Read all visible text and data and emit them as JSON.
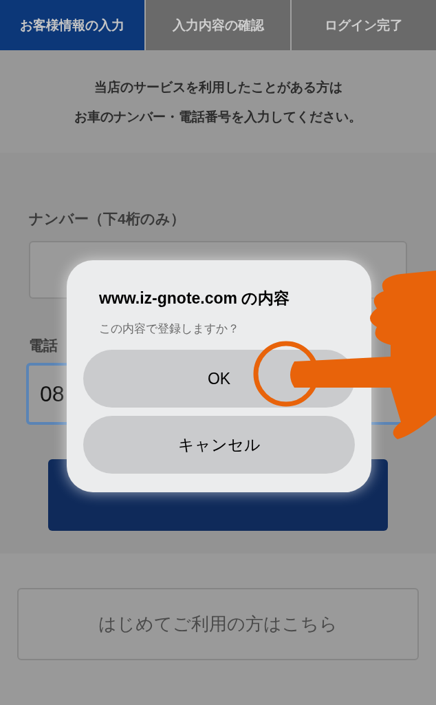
{
  "steps": [
    {
      "label": "お客様情報の入力",
      "selected": true
    },
    {
      "label": "入力内容の確認",
      "selected": false
    },
    {
      "label": "ログイン完了",
      "selected": false
    }
  ],
  "intro": [
    "当店のサービスを利用したことがある方は",
    "お車のナンバー・電話番号を入力してください。"
  ],
  "form": {
    "number_label": "ナンバー（下4桁のみ）",
    "phone_label": "電話",
    "phone_value": "08"
  },
  "dialog": {
    "title": "www.iz-gnote.com の内容",
    "message": "この内容で登録しますか？",
    "buttons": [
      "OK",
      "キャンセル"
    ]
  },
  "first_time_link": "はじめてご利用の方はこちら"
}
